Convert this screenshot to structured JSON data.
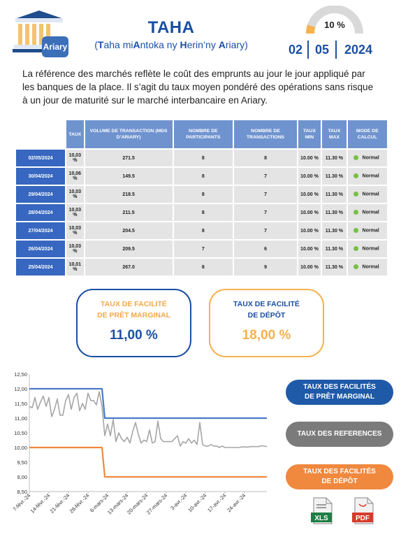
{
  "header": {
    "logo_label": "Ariary",
    "title": "TAHA",
    "subtitle_parts": [
      {
        "text": "(",
        "bold": false
      },
      {
        "text": "T",
        "bold": true
      },
      {
        "text": "aha mi",
        "bold": false
      },
      {
        "text": "A",
        "bold": true
      },
      {
        "text": "ntoka ny ",
        "bold": false
      },
      {
        "text": "H",
        "bold": true
      },
      {
        "text": "erin’ny ",
        "bold": false
      },
      {
        "text": "A",
        "bold": true
      },
      {
        "text": "riary)",
        "bold": false
      }
    ],
    "gauge_value": "10 %",
    "gauge_fraction": 0.1,
    "date": {
      "day": "02",
      "month": "05",
      "year": "2024"
    }
  },
  "description": "La référence des marchés reflète le coût des emprunts au jour le jour appliqué par les banques de la place. Il s’agit du taux moyen pondéré des opérations sans risque à un jour de maturité sur le marché interbancaire en Ariary.",
  "table": {
    "headers": [
      "TAUX",
      "VOLUME DE TRANSACTION (MDS D’ARIARY)",
      "NOMBRE DE PARTICIPANTS",
      "NOMBRE DE TRANSACTIONS",
      "TAUX MIN",
      "TAUX MAX",
      "MODE DE CALCUL"
    ],
    "rows": [
      {
        "date": "02/05/2024",
        "taux": "10,03 %",
        "volume": "271.5",
        "participants": "8",
        "transactions": "8",
        "min": "10.00 %",
        "max": "11.30 %",
        "mode": "Normal"
      },
      {
        "date": "30/04/2024",
        "taux": "10,06 %",
        "volume": "149.5",
        "participants": "8",
        "transactions": "7",
        "min": "10.00 %",
        "max": "11.30 %",
        "mode": "Normal"
      },
      {
        "date": "29/04/2024",
        "taux": "10,03 %",
        "volume": "218.5",
        "participants": "8",
        "transactions": "7",
        "min": "10.00 %",
        "max": "11.30 %",
        "mode": "Normal"
      },
      {
        "date": "28/04/2024",
        "taux": "10,03 %",
        "volume": "211.5",
        "participants": "8",
        "transactions": "7",
        "min": "10.00 %",
        "max": "11.30 %",
        "mode": "Normal"
      },
      {
        "date": "27/04/2024",
        "taux": "10,03 %",
        "volume": "204.5",
        "participants": "8",
        "transactions": "7",
        "min": "10.00 %",
        "max": "11.30 %",
        "mode": "Normal"
      },
      {
        "date": "26/04/2024",
        "taux": "10,03 %",
        "volume": "209.5",
        "participants": "7",
        "transactions": "6",
        "min": "10.00 %",
        "max": "11.30 %",
        "mode": "Normal"
      },
      {
        "date": "25/04/2024",
        "taux": "10,01 %",
        "volume": "267.0",
        "participants": "8",
        "transactions": "9",
        "min": "10.00 %",
        "max": "11.30 %",
        "mode": "Normal"
      }
    ],
    "status_color": "#76c043"
  },
  "boxes": {
    "pret": {
      "label_1": "TAUX DE FACILITÉ",
      "label_2": "DE PRÊT MARGINAL",
      "value": "11,00 %"
    },
    "depot": {
      "label_1": "TAUX DE FACILITÉ",
      "label_2": "DE DÉPÔT",
      "value": "18,00 %"
    }
  },
  "buttons": {
    "pret": {
      "line_1": "TAUX DES FACILITÉS",
      "line_2": "DE PRÊT MARGINAL"
    },
    "references": {
      "line_1": "TAUX DES REFERENCES"
    },
    "depot": {
      "line_1": "TAUX DES FACILITÉS",
      "line_2": "DE DÉPÔT"
    }
  },
  "downloads": {
    "xls": "XLS",
    "pdf": "PDF"
  },
  "colors": {
    "primary": "#1a4fa3",
    "orange": "#f0883e",
    "gray": "#7b7b7b",
    "yellow": "#f5b24f"
  },
  "chart_data": {
    "type": "line",
    "ylim": [
      8.5,
      12.5
    ],
    "yticks": [
      "12,50",
      "12,00",
      "11,50",
      "11,00",
      "10,50",
      "10,00",
      "9,50",
      "9,00",
      "8,50"
    ],
    "xticks": [
      "7-févr.-24",
      "14-févr.-24",
      "21-févr.-24",
      "28-févr.-24",
      "6-mars-24",
      "13-mars-24",
      "20-mars-24",
      "27-mars-24",
      "3-avr.-24",
      "10-avr.-24",
      "17-avr.-24",
      "24-avr.-24"
    ],
    "x_start": "7-févr.-24",
    "x_end": "2-mai-24",
    "series": [
      {
        "color": "#4a7bc8",
        "step": true,
        "points": [
          [
            "7-févr.-24",
            12.0
          ],
          [
            "4-mars-24",
            12.0
          ],
          [
            "5-mars-24",
            11.0
          ],
          [
            "2-mai-24",
            11.0
          ]
        ]
      },
      {
        "color": "#f0883e",
        "step": true,
        "points": [
          [
            "7-févr.-24",
            10.0
          ],
          [
            "4-mars-24",
            10.0
          ],
          [
            "5-mars-24",
            9.0
          ],
          [
            "2-mai-24",
            9.0
          ]
        ]
      },
      {
        "color": "#a6a6a6",
        "points": [
          [
            "7-févr.-24",
            11.4
          ],
          [
            "8-févr.-24",
            11.35
          ],
          [
            "9-févr.-24",
            11.7
          ],
          [
            "10-févr.-24",
            11.3
          ],
          [
            "11-févr.-24",
            11.55
          ],
          [
            "12-févr.-24",
            11.75
          ],
          [
            "13-févr.-24",
            11.4
          ],
          [
            "14-févr.-24",
            11.7
          ],
          [
            "15-févr.-24",
            11.05
          ],
          [
            "16-févr.-24",
            11.3
          ],
          [
            "17-févr.-24",
            11.65
          ],
          [
            "18-févr.-24",
            11.1
          ],
          [
            "19-févr.-24",
            11.1
          ],
          [
            "20-févr.-24",
            11.6
          ],
          [
            "21-févr.-24",
            11.8
          ],
          [
            "22-févr.-24",
            11.3
          ],
          [
            "23-févr.-24",
            11.7
          ],
          [
            "24-févr.-24",
            11.85
          ],
          [
            "25-févr.-24",
            11.25
          ],
          [
            "26-févr.-24",
            11.5
          ],
          [
            "27-févr.-24",
            11.3
          ],
          [
            "28-févr.-24",
            11.85
          ],
          [
            "29-févr.-24",
            11.6
          ],
          [
            "1-mars-24",
            11.6
          ],
          [
            "2-mars-24",
            11.45
          ],
          [
            "3-mars-24",
            11.9
          ],
          [
            "4-mars-24",
            11.4
          ],
          [
            "5-mars-24",
            10.4
          ],
          [
            "6-mars-24",
            10.8
          ],
          [
            "7-mars-24",
            10.4
          ],
          [
            "8-mars-24",
            10.95
          ],
          [
            "9-mars-24",
            10.2
          ],
          [
            "10-mars-24",
            10.5
          ],
          [
            "11-mars-24",
            10.3
          ],
          [
            "12-mars-24",
            10.2
          ],
          [
            "13-mars-24",
            10.35
          ],
          [
            "14-mars-24",
            10.15
          ],
          [
            "15-mars-24",
            10.55
          ],
          [
            "16-mars-24",
            10.85
          ],
          [
            "17-mars-24",
            10.45
          ],
          [
            "18-mars-24",
            10.15
          ],
          [
            "19-mars-24",
            10.25
          ],
          [
            "20-mars-24",
            10.2
          ],
          [
            "21-mars-24",
            10.6
          ],
          [
            "22-mars-24",
            10.15
          ],
          [
            "23-mars-24",
            10.2
          ],
          [
            "24-mars-24",
            10.9
          ],
          [
            "25-mars-24",
            10.3
          ],
          [
            "26-mars-24",
            10.2
          ],
          [
            "27-mars-24",
            10.2
          ],
          [
            "28-mars-24",
            10.2
          ],
          [
            "29-mars-24",
            10.2
          ],
          [
            "30-mars-24",
            10.3
          ],
          [
            "31-mars-24",
            10.4
          ],
          [
            "1-avr.-24",
            10.05
          ],
          [
            "2-avr.-24",
            10.2
          ],
          [
            "3-avr.-24",
            10.15
          ],
          [
            "4-avr.-24",
            10.3
          ],
          [
            "5-avr.-24",
            10.15
          ],
          [
            "6-avr.-24",
            10.25
          ],
          [
            "7-avr.-24",
            10.1
          ],
          [
            "8-avr.-24",
            10.85
          ],
          [
            "9-avr.-24",
            10.1
          ],
          [
            "10-avr.-24",
            10.05
          ],
          [
            "11-avr.-24",
            10.05
          ],
          [
            "12-avr.-24",
            10.1
          ],
          [
            "13-avr.-24",
            10.05
          ],
          [
            "14-avr.-24",
            10.05
          ],
          [
            "15-avr.-24",
            10.0
          ],
          [
            "16-avr.-24",
            10.05
          ],
          [
            "17-avr.-24",
            10.0
          ],
          [
            "18-avr.-24",
            10.0
          ],
          [
            "19-avr.-24",
            10.0
          ],
          [
            "20-avr.-24",
            10.0
          ],
          [
            "21-avr.-24",
            10.0
          ],
          [
            "22-avr.-24",
            10.0
          ],
          [
            "23-avr.-24",
            10.02
          ],
          [
            "24-avr.-24",
            10.02
          ],
          [
            "25-avr.-24",
            10.01
          ],
          [
            "26-avr.-24",
            10.03
          ],
          [
            "27-avr.-24",
            10.03
          ],
          [
            "28-avr.-24",
            10.03
          ],
          [
            "29-avr.-24",
            10.03
          ],
          [
            "30-avr.-24",
            10.06
          ],
          [
            "2-mai-24",
            10.03
          ]
        ]
      }
    ]
  }
}
